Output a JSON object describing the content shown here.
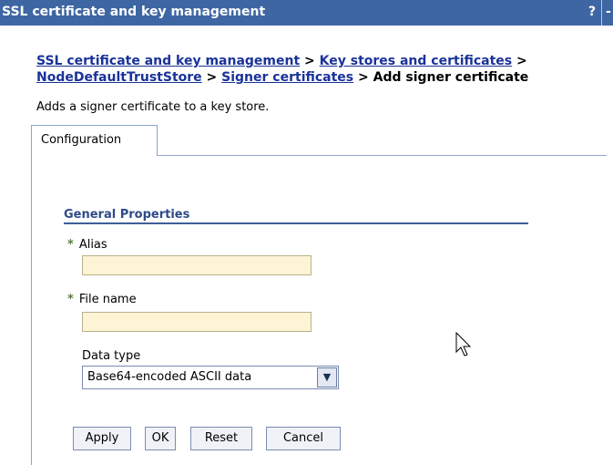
{
  "window": {
    "title": "SSL certificate and key management",
    "help_label": "?",
    "minimize_label": "-"
  },
  "breadcrumb": {
    "items": [
      "SSL certificate and key management",
      "Key stores and certificates",
      "NodeDefaultTrustStore",
      "Signer certificates"
    ],
    "separator": ">",
    "current": "Add signer certificate"
  },
  "description": "Adds a signer certificate to a key store.",
  "tabs": [
    {
      "label": "Configuration"
    }
  ],
  "section": {
    "title": "General Properties"
  },
  "form": {
    "alias": {
      "label": "Alias",
      "value": ""
    },
    "file_name": {
      "label": "File name",
      "value": ""
    },
    "data_type": {
      "label": "Data type",
      "selected": "Base64-encoded ASCII data"
    },
    "required_marker": "*"
  },
  "buttons": {
    "apply": "Apply",
    "ok": "OK",
    "reset": "Reset",
    "cancel": "Cancel"
  },
  "icons": {
    "dropdown": "chevron-down-icon",
    "cursor": "mouse-pointer-icon"
  },
  "colors": {
    "title_bar": "#3e66a3",
    "link": "#1a3299",
    "required_field_bg": "#fdf4d6",
    "section_title": "#2e4a87"
  }
}
